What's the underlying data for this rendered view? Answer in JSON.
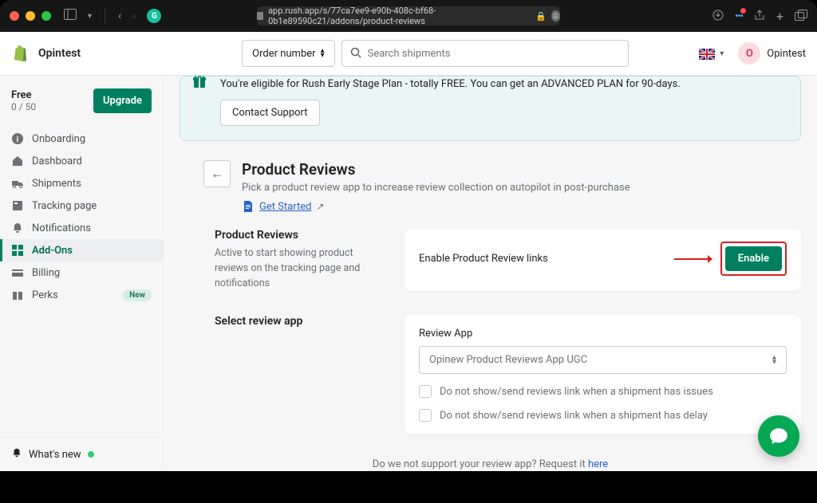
{
  "browser": {
    "url": "app.rush.app/s/77ca7ee9-e90b-408c-bf68-0b1e89590c21/addons/product-reviews"
  },
  "header": {
    "store_name": "Opintest",
    "order_dropdown": "Order number",
    "search_placeholder": "Search shipments",
    "user_name": "Opintest",
    "user_initial": "O"
  },
  "sidebar": {
    "plan_label": "Free",
    "usage": "0 / 50",
    "upgrade": "Upgrade",
    "items": [
      {
        "label": "Onboarding"
      },
      {
        "label": "Dashboard"
      },
      {
        "label": "Shipments"
      },
      {
        "label": "Tracking page"
      },
      {
        "label": "Notifications"
      },
      {
        "label": "Add-Ons"
      },
      {
        "label": "Billing"
      },
      {
        "label": "Perks"
      }
    ],
    "new_badge": "New",
    "whats_new": "What's new"
  },
  "banner": {
    "text": "You're eligible for Rush Early Stage Plan - totally FREE. You can get an ADVANCED PLAN for 90-days.",
    "button": "Contact Support"
  },
  "page": {
    "title": "Product Reviews",
    "subtitle": "Pick a product review app to increase review collection on autopilot in post-purchase",
    "get_started": "Get Started"
  },
  "section1": {
    "title": "Product Reviews",
    "desc": "Active to start showing product reviews on the tracking page and notifications",
    "card_label": "Enable Product Review links",
    "enable_btn": "Enable"
  },
  "section2": {
    "title": "Select review app",
    "form_label": "Review App",
    "selected": "Opinew Product Reviews App UGC",
    "check1": "Do not show/send reviews link when a shipment has issues",
    "check2": "Do not show/send reviews link when a shipment has delay"
  },
  "footer": {
    "text": "Do we not support your review app? Request it ",
    "link": "here"
  }
}
